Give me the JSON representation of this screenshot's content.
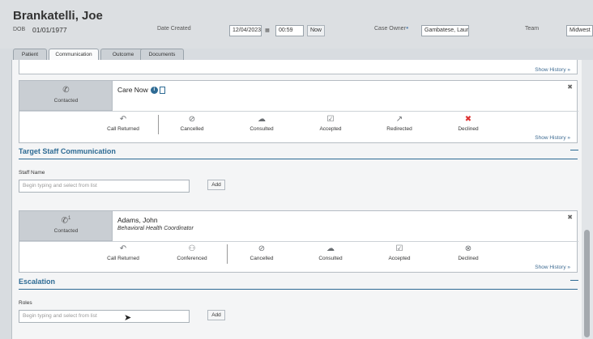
{
  "patient": {
    "name": "Brankatelli, Joe",
    "dob_label": "DOB",
    "dob": "01/01/1977"
  },
  "header": {
    "date_created_label": "Date Created",
    "date_value": "12/04/2023",
    "time_value": "00:59",
    "now_label": "Now",
    "case_owner_label": "Case Owner",
    "case_owner_value": "Gambatese, Lauren",
    "team_label": "Team",
    "team_value": "Midwest R"
  },
  "tabs": [
    {
      "label": "Patient"
    },
    {
      "label": "Communication"
    },
    {
      "label": "Outcome"
    },
    {
      "label": "Documents"
    }
  ],
  "top_card": {
    "show_history": "Show History"
  },
  "care_now_card": {
    "status": "Contacted",
    "title": "Care Now",
    "actions": [
      {
        "label": "Call Returned",
        "icon": "call-returned-icon"
      },
      {
        "label": "Cancelled",
        "icon": "cancelled-icon"
      },
      {
        "label": "Consulted",
        "icon": "consulted-icon"
      },
      {
        "label": "Accepted",
        "icon": "accepted-icon"
      },
      {
        "label": "Redirected",
        "icon": "redirected-icon"
      },
      {
        "label": "Declined",
        "icon": "declined-icon"
      }
    ],
    "show_history": "Show History"
  },
  "target_staff": {
    "title": "Target Staff Communication",
    "field_label": "Staff Name",
    "placeholder": "Begin typing and select from list",
    "add_label": "Add"
  },
  "adams_card": {
    "status": "Contacted",
    "call_count": "1",
    "title": "Adams, John",
    "subtitle": "Behavioral Health Coordinator",
    "actions": [
      {
        "label": "Call Returned",
        "icon": "call-returned-icon"
      },
      {
        "label": "Conferenced",
        "icon": "conferenced-icon"
      },
      {
        "label": "Cancelled",
        "icon": "cancelled-icon"
      },
      {
        "label": "Consulted",
        "icon": "consulted-icon"
      },
      {
        "label": "Accepted",
        "icon": "accepted-icon"
      },
      {
        "label": "Declined",
        "icon": "declined-icon"
      }
    ],
    "show_history": "Show History"
  },
  "escalation": {
    "title": "Escalation",
    "field_label": "Roles",
    "placeholder": "Begin typing and select from list",
    "add_label": "Add"
  },
  "colors": {
    "accent": "#2e6b94",
    "declined": "#d33333"
  }
}
